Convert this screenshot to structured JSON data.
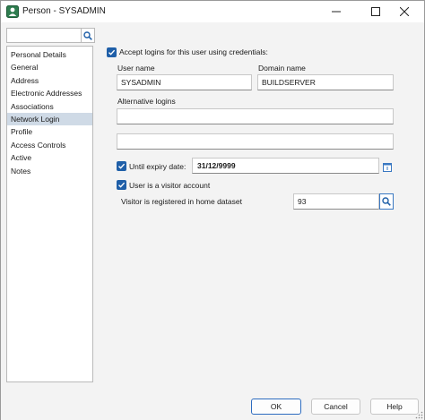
{
  "window": {
    "title": "Person - SYSADMIN"
  },
  "sidebar": {
    "search_value": "",
    "items": [
      {
        "label": "Personal Details"
      },
      {
        "label": "General"
      },
      {
        "label": "Address"
      },
      {
        "label": "Electronic Addresses"
      },
      {
        "label": "Associations"
      },
      {
        "label": "Network Login",
        "selected": true
      },
      {
        "label": "Profile"
      },
      {
        "label": "Access Controls"
      },
      {
        "label": "Active"
      },
      {
        "label": "Notes"
      }
    ]
  },
  "network_login": {
    "accept_logins_label": "Accept logins for this user using credentials:",
    "accept_logins_checked": true,
    "user_name_label": "User name",
    "user_name_value": "SYSADMIN",
    "domain_name_label": "Domain name",
    "domain_name_value": "BUILDSERVER",
    "alternative_logins_label": "Alternative logins",
    "alternative_login_1": "",
    "alternative_login_2": "",
    "until_expiry_label": "Until expiry date:",
    "until_expiry_checked": true,
    "expiry_date_value": "31/12/9999",
    "visitor_label": "User is a visitor account",
    "visitor_checked": true,
    "home_dataset_label": "Visitor is registered in home dataset",
    "home_dataset_value": "93"
  },
  "footer": {
    "ok_label": "OK",
    "cancel_label": "Cancel",
    "help_label": "Help"
  },
  "colors": {
    "accent": "#1f5fa8",
    "selected_nav": "#cfdae6"
  }
}
